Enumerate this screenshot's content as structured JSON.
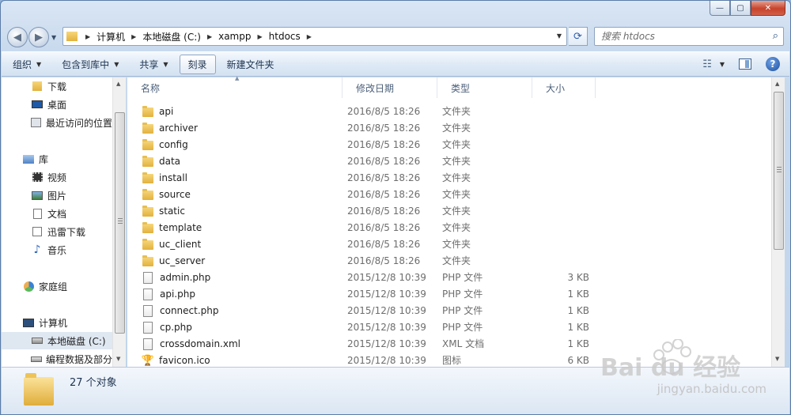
{
  "titlebar": {
    "minimize_glyph": "—",
    "maximize_glyph": "▢",
    "close_glyph": "✕"
  },
  "address": {
    "crumbs": [
      "计算机",
      "本地磁盘 (C:)",
      "xampp",
      "htdocs"
    ]
  },
  "search": {
    "placeholder": "搜索 htdocs"
  },
  "commands": {
    "organize": "组织",
    "include_library": "包含到库中",
    "share": "共享",
    "burn": "刻录",
    "new_folder": "新建文件夹"
  },
  "nav": {
    "items": [
      {
        "label": "下载",
        "icon": "download-folder-icon"
      },
      {
        "label": "桌面",
        "icon": "desktop-icon"
      },
      {
        "label": "最近访问的位置",
        "icon": "recent-places-icon"
      },
      {
        "label": "库",
        "icon": "library-icon"
      },
      {
        "label": "视频",
        "icon": "videos-icon"
      },
      {
        "label": "图片",
        "icon": "pictures-icon"
      },
      {
        "label": "文档",
        "icon": "documents-icon"
      },
      {
        "label": "迅雷下载",
        "icon": "thunder-download-icon"
      },
      {
        "label": "音乐",
        "icon": "music-icon"
      },
      {
        "label": "家庭组",
        "icon": "homegroup-icon"
      },
      {
        "label": "计算机",
        "icon": "computer-icon"
      },
      {
        "label": "本地磁盘 (C:)",
        "icon": "local-disk-icon"
      },
      {
        "label": "编程数据及部分",
        "icon": "drive-icon"
      }
    ]
  },
  "columns": {
    "name": "名称",
    "date": "修改日期",
    "type": "类型",
    "size": "大小"
  },
  "files": [
    {
      "name": "api",
      "date": "2016/8/5 18:26",
      "type": "文件夹",
      "size": "",
      "icon": "folder-icon"
    },
    {
      "name": "archiver",
      "date": "2016/8/5 18:26",
      "type": "文件夹",
      "size": "",
      "icon": "folder-icon"
    },
    {
      "name": "config",
      "date": "2016/8/5 18:26",
      "type": "文件夹",
      "size": "",
      "icon": "folder-icon"
    },
    {
      "name": "data",
      "date": "2016/8/5 18:26",
      "type": "文件夹",
      "size": "",
      "icon": "folder-icon"
    },
    {
      "name": "install",
      "date": "2016/8/5 18:26",
      "type": "文件夹",
      "size": "",
      "icon": "folder-icon"
    },
    {
      "name": "source",
      "date": "2016/8/5 18:26",
      "type": "文件夹",
      "size": "",
      "icon": "folder-icon"
    },
    {
      "name": "static",
      "date": "2016/8/5 18:26",
      "type": "文件夹",
      "size": "",
      "icon": "folder-icon"
    },
    {
      "name": "template",
      "date": "2016/8/5 18:26",
      "type": "文件夹",
      "size": "",
      "icon": "folder-icon"
    },
    {
      "name": "uc_client",
      "date": "2016/8/5 18:26",
      "type": "文件夹",
      "size": "",
      "icon": "folder-icon"
    },
    {
      "name": "uc_server",
      "date": "2016/8/5 18:26",
      "type": "文件夹",
      "size": "",
      "icon": "folder-icon"
    },
    {
      "name": "admin.php",
      "date": "2015/12/8 10:39",
      "type": "PHP 文件",
      "size": "3 KB",
      "icon": "php-file-icon"
    },
    {
      "name": "api.php",
      "date": "2015/12/8 10:39",
      "type": "PHP 文件",
      "size": "1 KB",
      "icon": "php-file-icon"
    },
    {
      "name": "connect.php",
      "date": "2015/12/8 10:39",
      "type": "PHP 文件",
      "size": "1 KB",
      "icon": "php-file-icon"
    },
    {
      "name": "cp.php",
      "date": "2015/12/8 10:39",
      "type": "PHP 文件",
      "size": "1 KB",
      "icon": "php-file-icon"
    },
    {
      "name": "crossdomain.xml",
      "date": "2015/12/8 10:39",
      "type": "XML 文档",
      "size": "1 KB",
      "icon": "xml-file-icon"
    },
    {
      "name": "favicon.ico",
      "date": "2015/12/8 10:39",
      "type": "图标",
      "size": "6 KB",
      "icon": "ico-file-icon"
    }
  ],
  "status": {
    "count": "27 个对象"
  },
  "watermark": {
    "brand": "Bai du 经验",
    "url": "jingyan.baidu.com"
  }
}
